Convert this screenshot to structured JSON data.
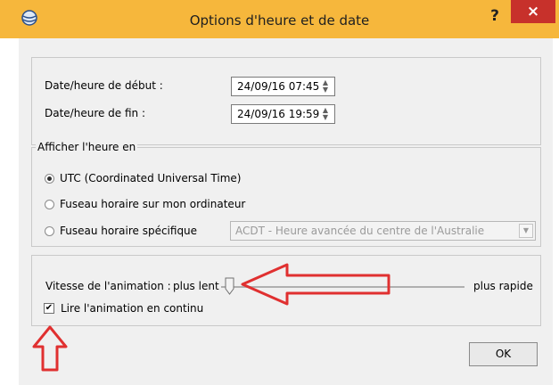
{
  "window": {
    "title": "Options d'heure et de date",
    "help_label": "?",
    "close_label": "×"
  },
  "date_group": {
    "start_label": "Date/heure de début :",
    "start_value": "24/09/16 07:45",
    "end_label": "Date/heure de fin :",
    "end_value": "24/09/16 19:59"
  },
  "timezone_group": {
    "legend": "Afficher l'heure en",
    "options": [
      {
        "label": "UTC (Coordinated Universal Time)",
        "selected": true
      },
      {
        "label": "Fuseau horaire sur mon ordinateur",
        "selected": false
      },
      {
        "label": "Fuseau horaire spécifique",
        "selected": false
      }
    ],
    "specific_timezone_value": "ACDT - Heure avancée du centre de l'Australie"
  },
  "animation_group": {
    "speed_label": "Vitesse de l'animation :",
    "slow_label": "plus lent",
    "fast_label": "plus rapide",
    "speed_level": 0.0,
    "loop_label": "Lire l'animation en continu",
    "loop_checked": true
  },
  "ok_label": "OK",
  "colors": {
    "title_bar": "#f6b73c",
    "close_button": "#c7312b",
    "annotation_arrow": "#e03030"
  },
  "icons": {
    "app": "globe-icon",
    "annotation": "arrow-icon"
  }
}
